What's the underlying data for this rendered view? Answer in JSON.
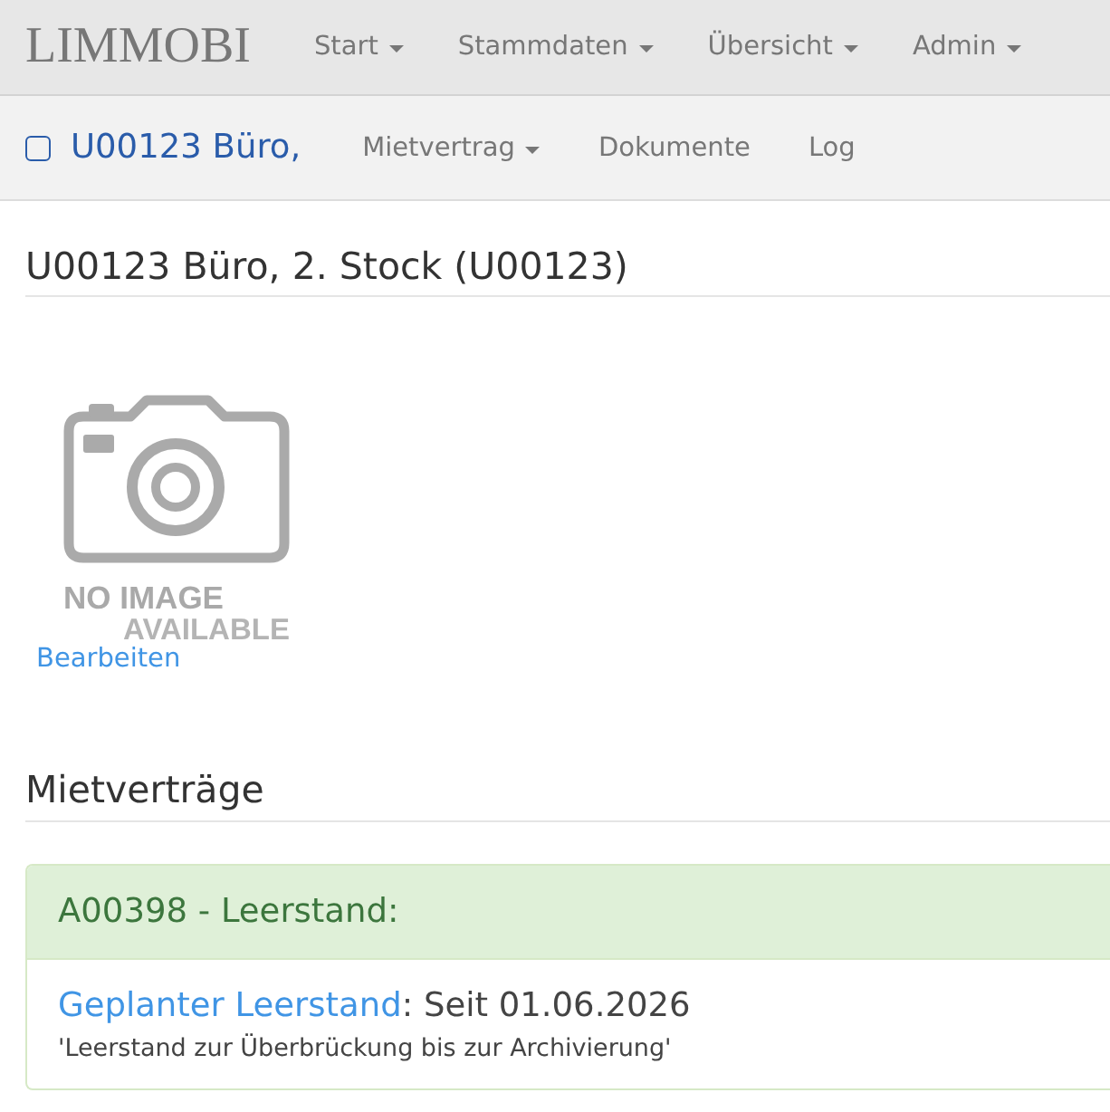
{
  "navbar": {
    "brand": "LIMMOBI",
    "menus": [
      {
        "label": "Start",
        "dropdown": true
      },
      {
        "label": "Stammdaten",
        "dropdown": true
      },
      {
        "label": "Übersicht",
        "dropdown": true
      },
      {
        "label": "Admin",
        "dropdown": true
      }
    ]
  },
  "subnav": {
    "object": "U00123 Büro,",
    "items": [
      {
        "label": "Mietvertrag",
        "dropdown": true
      },
      {
        "label": "Dokumente",
        "dropdown": false
      },
      {
        "label": "Log",
        "dropdown": false
      }
    ]
  },
  "object": {
    "title": "U00123 Büro, 2. Stock (U00123)",
    "image_placeholder": {
      "line_1": "NO IMAGE",
      "line_2": "AVAILABLE"
    },
    "edit_link": "Bearbeiten"
  },
  "contracts": {
    "heading": "Mietverträge",
    "panels": [
      {
        "kind": "success",
        "title": "A00398 - Leerstand:",
        "status_link": "Geplanter Leerstand",
        "status_text": ": Seit 01.06.2026",
        "note": "'Leerstand zur Überbrückung bis zur Archivierung'"
      }
    ]
  }
}
